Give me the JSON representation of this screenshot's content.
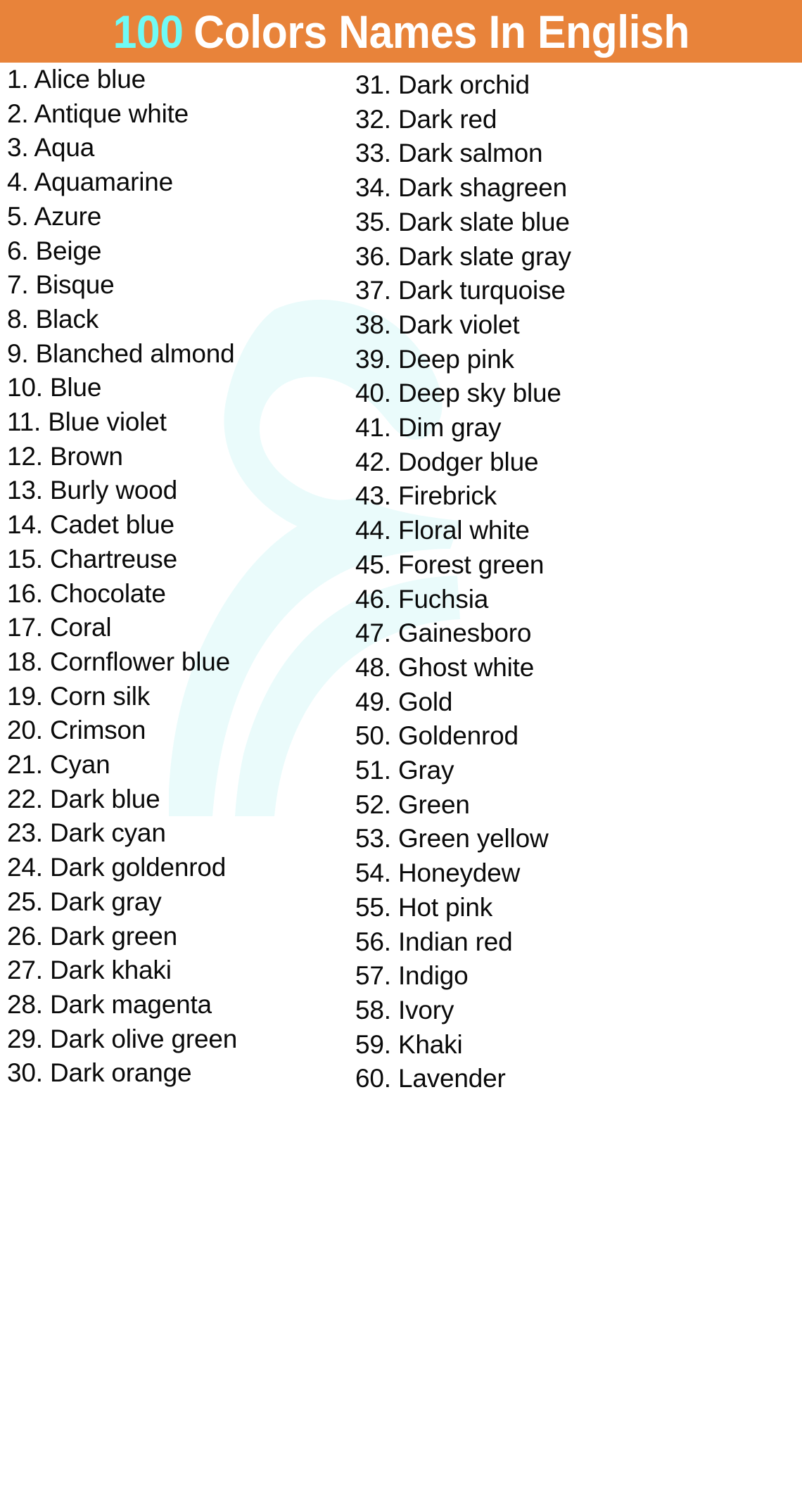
{
  "header": {
    "count": "100",
    "title": "Colors Names In English",
    "background_color": "#e8833a",
    "count_color": "#6ffaf5",
    "title_color": "#ffffff"
  },
  "watermark": {
    "name": "swoosh-logo-watermark",
    "color": "#eafbfb"
  },
  "list": {
    "columns": [
      {
        "name": "left-column",
        "items": [
          {
            "number": "1.",
            "label": "Alice blue"
          },
          {
            "number": "2.",
            "label": "Antique white"
          },
          {
            "number": "3.",
            "label": "Aqua"
          },
          {
            "number": "4.",
            "label": "Aquamarine"
          },
          {
            "number": "5.",
            "label": "Azure"
          },
          {
            "number": "6.",
            "label": "Beige"
          },
          {
            "number": "7.",
            "label": "Bisque"
          },
          {
            "number": "8.",
            "label": "Black"
          },
          {
            "number": "9.",
            "label": "Blanched almond"
          },
          {
            "number": "10.",
            "label": "Blue"
          },
          {
            "number": "11.",
            "label": "Blue violet"
          },
          {
            "number": "12.",
            "label": "Brown"
          },
          {
            "number": "13.",
            "label": "Burly wood"
          },
          {
            "number": "14.",
            "label": "Cadet blue"
          },
          {
            "number": "15.",
            "label": "Chartreuse"
          },
          {
            "number": "16.",
            "label": "Chocolate"
          },
          {
            "number": "17.",
            "label": "Coral"
          },
          {
            "number": "18.",
            "label": "Cornflower blue"
          },
          {
            "number": "19.",
            "label": "Corn silk"
          },
          {
            "number": "20.",
            "label": "Crimson"
          },
          {
            "number": "21.",
            "label": "Cyan"
          },
          {
            "number": "22.",
            "label": "Dark blue"
          },
          {
            "number": "23.",
            "label": "Dark cyan"
          },
          {
            "number": "24.",
            "label": "Dark goldenrod"
          },
          {
            "number": "25.",
            "label": "Dark gray"
          },
          {
            "number": "26.",
            "label": "Dark green"
          },
          {
            "number": "27.",
            "label": "Dark khaki"
          },
          {
            "number": "28.",
            "label": "Dark magenta"
          },
          {
            "number": "29.",
            "label": "Dark olive green"
          },
          {
            "number": "30.",
            "label": "Dark orange"
          }
        ]
      },
      {
        "name": "right-column",
        "items": [
          {
            "number": "31.",
            "label": "Dark orchid"
          },
          {
            "number": "32.",
            "label": "Dark red"
          },
          {
            "number": "33.",
            "label": "Dark salmon"
          },
          {
            "number": "34.",
            "label": "Dark shagreen"
          },
          {
            "number": "35.",
            "label": "Dark slate blue"
          },
          {
            "number": "36.",
            "label": "Dark slate gray"
          },
          {
            "number": "37.",
            "label": "Dark turquoise"
          },
          {
            "number": "38.",
            "label": "Dark violet"
          },
          {
            "number": "39.",
            "label": "Deep pink"
          },
          {
            "number": "40.",
            "label": "Deep sky blue"
          },
          {
            "number": "41.",
            "label": "Dim gray"
          },
          {
            "number": "42.",
            "label": "Dodger blue"
          },
          {
            "number": "43.",
            "label": "Firebrick"
          },
          {
            "number": "44.",
            "label": "Floral white"
          },
          {
            "number": "45.",
            "label": "Forest green"
          },
          {
            "number": "46.",
            "label": "Fuchsia"
          },
          {
            "number": "47.",
            "label": "Gainesboro"
          },
          {
            "number": "48.",
            "label": "Ghost white"
          },
          {
            "number": "49.",
            "label": "Gold"
          },
          {
            "number": "50.",
            "label": "Goldenrod"
          },
          {
            "number": "51.",
            "label": "Gray"
          },
          {
            "number": "52.",
            "label": "Green"
          },
          {
            "number": "53.",
            "label": "Green yellow"
          },
          {
            "number": "54.",
            "label": "Honeydew"
          },
          {
            "number": "55.",
            "label": "Hot pink"
          },
          {
            "number": "56.",
            "label": "Indian red"
          },
          {
            "number": "57.",
            "label": "Indigo"
          },
          {
            "number": "58.",
            "label": "Ivory"
          },
          {
            "number": "59.",
            "label": "Khaki"
          },
          {
            "number": "60.",
            "label": "Lavender"
          }
        ]
      }
    ]
  }
}
